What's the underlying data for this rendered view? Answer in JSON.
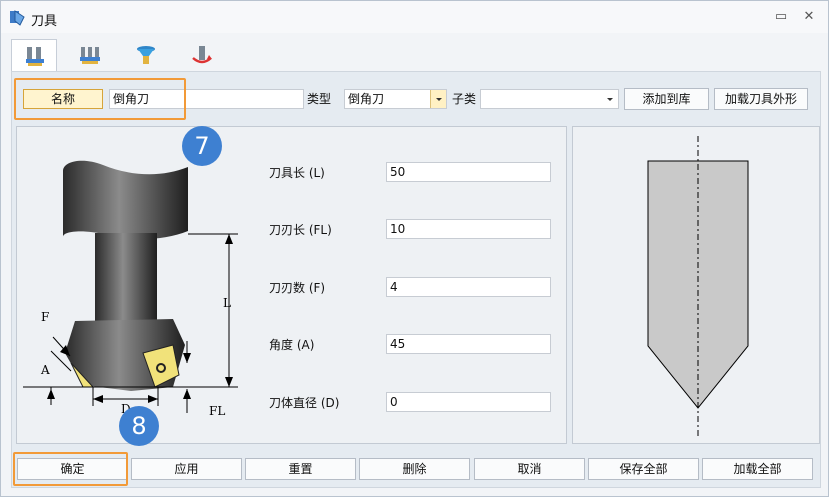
{
  "window": {
    "title": "刀具"
  },
  "tabs": [
    {
      "icon": "tool-library-icon"
    },
    {
      "icon": "tool-set-icon"
    },
    {
      "icon": "holder-icon"
    },
    {
      "icon": "tool-path-icon"
    }
  ],
  "toolbar": {
    "name_button": "名称",
    "name_value": "倒角刀",
    "type_label": "类型",
    "type_value": "倒角刀",
    "subclass_label": "子类",
    "subclass_value": "",
    "add_to_library": "添加到库",
    "load_shape": "加载刀具外形"
  },
  "params": [
    {
      "label": "刀具长 (L)",
      "value": "50"
    },
    {
      "label": "刀刃长 (FL)",
      "value": "10"
    },
    {
      "label": "刀刃数 (F)",
      "value": "4"
    },
    {
      "label": "角度 (A)",
      "value": "45"
    },
    {
      "label": "刀体直径 (D)",
      "value": "0"
    }
  ],
  "diagram_labels": {
    "f": "F",
    "a": "A",
    "l": "L",
    "d": "D",
    "fl": "FL"
  },
  "badges": {
    "first": "7",
    "second": "8"
  },
  "bottom": {
    "ok": "确定",
    "apply": "应用",
    "reset": "重置",
    "delete": "删除",
    "cancel": "取消",
    "save_all": "保存全部",
    "load_all": "加载全部"
  },
  "colors": {
    "highlight": "#f29a38",
    "badge": "#3e80d1",
    "tool_fill": "#c9c9c9"
  }
}
